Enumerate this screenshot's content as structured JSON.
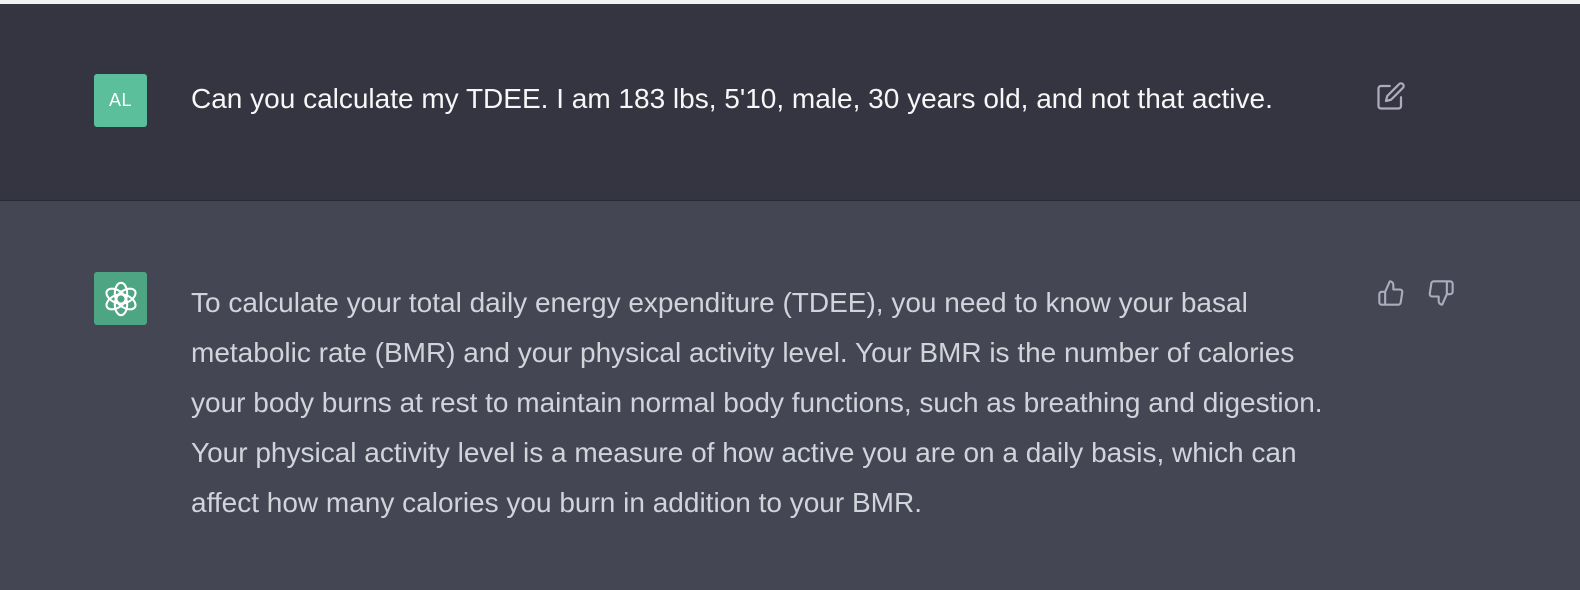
{
  "conversation": {
    "user_message": {
      "avatar_initials": "AL",
      "text": "Can you calculate my TDEE. I am 183 lbs, 5'10, male, 30 years old, and not that active."
    },
    "assistant_message": {
      "text": "To calculate your total daily energy expenditure (TDEE), you need to know your basal metabolic rate (BMR) and your physical activity level. Your BMR is the number of calories your body burns at rest to maintain normal body functions, such as breathing and digestion. Your physical activity level is a measure of how active you are on a daily basis, which can affect how many calories you burn in addition to your BMR."
    }
  },
  "icons": {
    "user_action": "edit-icon",
    "assistant_avatar": "openai-logo-icon",
    "feedback_up": "thumbs-up-icon",
    "feedback_down": "thumbs-down-icon"
  },
  "colors": {
    "user_row_bg": "#343541",
    "assistant_row_bg": "#444654",
    "user_avatar_bg": "#5bbf9c",
    "assistant_avatar_bg": "#4ea584",
    "icon_color": "#acacbe"
  }
}
